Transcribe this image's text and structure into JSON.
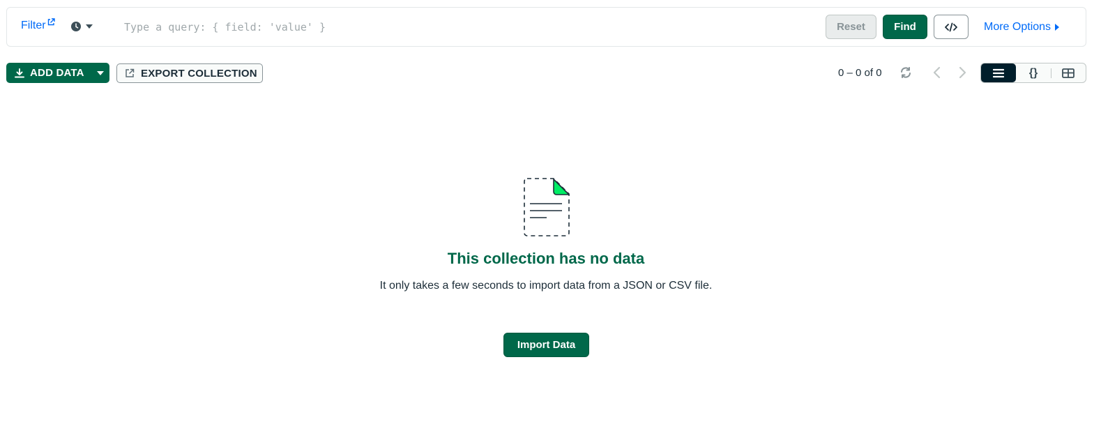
{
  "query_bar": {
    "filter_label": "Filter",
    "query_placeholder": "Type a query: { field: 'value' }",
    "reset_label": "Reset",
    "find_label": "Find",
    "more_options_label": "More Options"
  },
  "toolbar": {
    "add_data_label": "ADD DATA",
    "export_label": "EXPORT COLLECTION",
    "pagination_text": "0 – 0 of 0"
  },
  "view_toggle": {
    "json_label": "{}"
  },
  "empty_state": {
    "title": "This collection has no data",
    "description": "It only takes a few seconds to import data from a JSON or CSV file.",
    "import_label": "Import Data"
  },
  "colors": {
    "brand_green": "#00684a",
    "link_blue": "#016bf8",
    "dark_navy": "#001e2b",
    "icon_accent_green": "#00ed64"
  },
  "icons": [
    "external-link-icon",
    "clock-icon",
    "caret-down-icon",
    "code-icon",
    "caret-right-icon",
    "download-icon",
    "export-icon",
    "refresh-icon",
    "chevron-left-icon",
    "chevron-right-icon",
    "list-view-icon",
    "json-view-icon",
    "table-view-icon",
    "empty-document-icon"
  ]
}
